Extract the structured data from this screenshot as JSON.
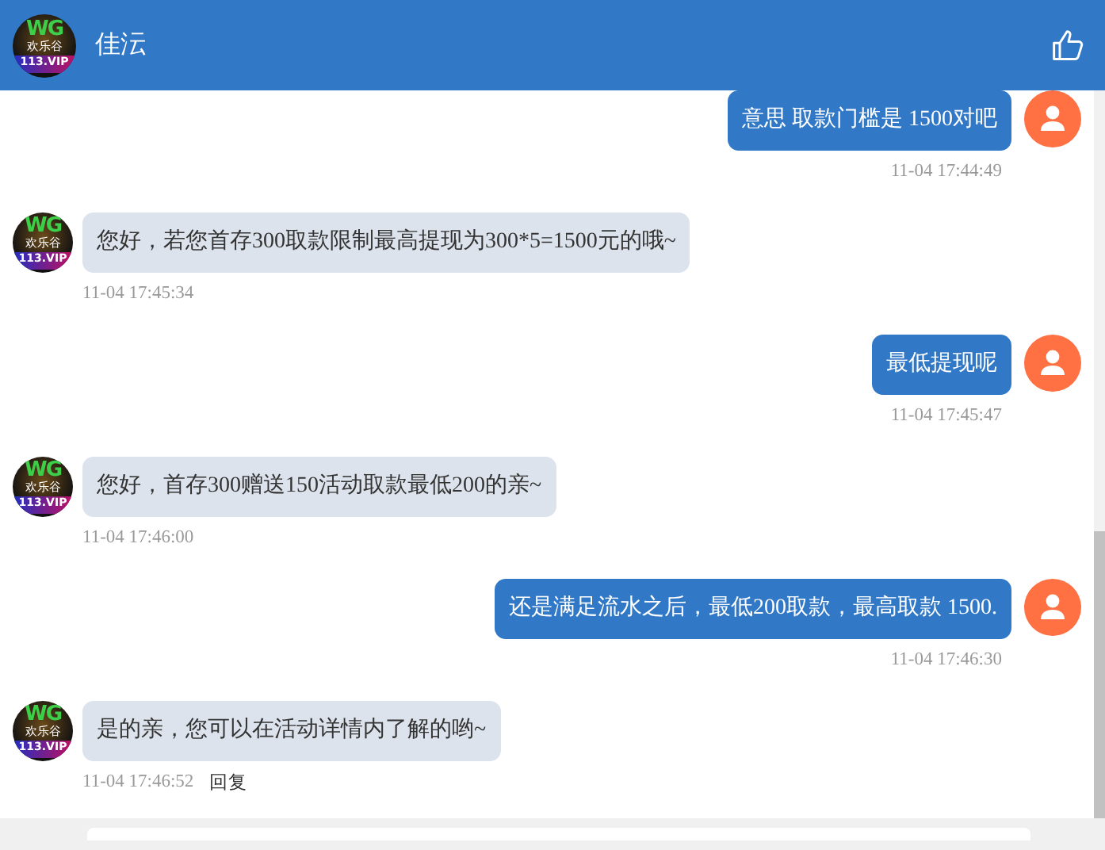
{
  "header": {
    "logo": {
      "mark": "WG",
      "name": "欢乐谷",
      "site": "113.VIP"
    },
    "title": "佳沄"
  },
  "messages": [
    {
      "kind": "sent",
      "text": "意思 取款门槛是 1500对吧",
      "time": "11-04 17:44:49"
    },
    {
      "kind": "received",
      "logo": {
        "mark": "WG",
        "name": "欢乐谷",
        "site": "113.VIP"
      },
      "text": "您好，若您首存300取款限制最高提现为300*5=1500元的哦~",
      "time": "11-04 17:45:34"
    },
    {
      "kind": "sent",
      "text": "最低提现呢",
      "time": "11-04 17:45:47"
    },
    {
      "kind": "received",
      "logo": {
        "mark": "WG",
        "name": "欢乐谷",
        "site": "113.VIP"
      },
      "text": "您好，首存300赠送150活动取款最低200的亲~",
      "time": "11-04 17:46:00"
    },
    {
      "kind": "sent",
      "text": "还是满足流水之后，最低200取款，最高取款 1500.",
      "time": "11-04 17:46:30"
    },
    {
      "kind": "received",
      "logo": {
        "mark": "WG",
        "name": "欢乐谷",
        "site": "113.VIP"
      },
      "text": "是的亲，您可以在活动详情内了解的哟~",
      "time": "11-04 17:46:52",
      "action": "回复"
    }
  ]
}
